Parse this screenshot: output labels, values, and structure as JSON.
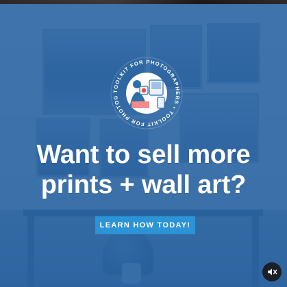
{
  "headline": {
    "line1": "Want to sell more",
    "line2": "prints + wall art?"
  },
  "cta": {
    "label": "LEARN HOW TODAY!"
  },
  "logo": {
    "ring_text": "TOOLKIT FOR PHOTOGRAPHERS • TOOLKIT FOR PHOTOGRAPHERS •",
    "icon": "toolkit-for-photographers-logo"
  },
  "controls": {
    "mute_icon": "speaker-muted-icon"
  },
  "colors": {
    "overlay": "#1454A0",
    "cta_bg": "#2B93D6",
    "text": "#FFFFFF",
    "mute_bg": "#1B1F26"
  }
}
